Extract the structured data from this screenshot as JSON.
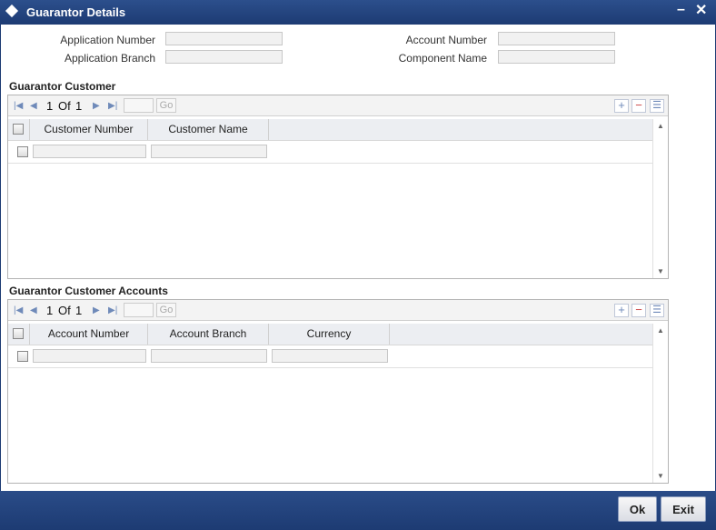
{
  "window": {
    "title": "Guarantor Details",
    "minimize_icon": "minimize-icon",
    "close_icon": "close-icon"
  },
  "form": {
    "application_number_label": "Application Number",
    "application_branch_label": "Application Branch",
    "account_number_label": "Account Number",
    "component_name_label": "Component Name",
    "application_number_value": "",
    "application_branch_value": "",
    "account_number_value": "",
    "component_name_value": ""
  },
  "guarantor_customer": {
    "title": "Guarantor Customer",
    "pager": {
      "current": "1",
      "of_label": "Of",
      "total": "1",
      "go_label": "Go"
    },
    "columns": [
      "Customer Number",
      "Customer Name"
    ],
    "rows": [
      {
        "customer_number": "",
        "customer_name": ""
      }
    ]
  },
  "guarantor_customer_accounts": {
    "title": "Guarantor Customer Accounts",
    "pager": {
      "current": "1",
      "of_label": "Of",
      "total": "1",
      "go_label": "Go"
    },
    "columns": [
      "Account Number",
      "Account Branch",
      "Currency"
    ],
    "rows": [
      {
        "account_number": "",
        "account_branch": "",
        "currency": ""
      }
    ]
  },
  "footer": {
    "ok_label": "Ok",
    "exit_label": "Exit"
  },
  "colors": {
    "titlebar": "#1d3b73",
    "footer": "#1d3b73",
    "header_row": "#eceef2"
  }
}
